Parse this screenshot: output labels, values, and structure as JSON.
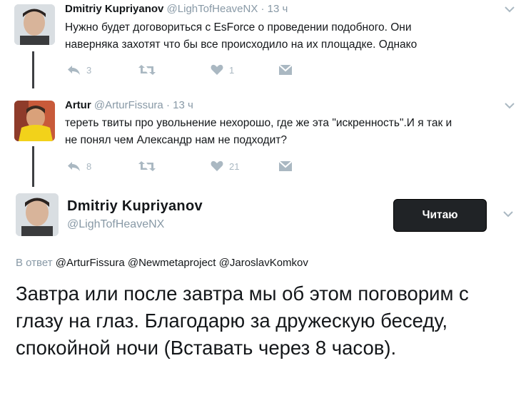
{
  "tweets": [
    {
      "name": "Dmitriy Kupriyanov",
      "handle": "@LighTofHeaveNX",
      "time": "· 13 ч",
      "lines": [
        "Нужно будет договориться с EsForce о проведении подобного. Они",
        "наверняка захотят что бы все происходило на их площадке. Однако"
      ],
      "reply_count": "3",
      "retweet_count": "",
      "like_count": "1"
    },
    {
      "name": "Artur",
      "handle": "@ArturFissura",
      "time": "· 13 ч",
      "lines": [
        "тереть твиты про увольнение нехорошо, где же эта \"искренность\".И я так и",
        "не понял чем Александр нам не подходит?"
      ],
      "reply_count": "8",
      "retweet_count": "",
      "like_count": "21"
    }
  ],
  "main_tweet": {
    "name": "Dmitriy Kupriyanov",
    "handle": "@LighTofHeaveNX",
    "follow_label": "Читаю",
    "reply_prefix": "В ответ",
    "mentions": [
      "@ArturFissura",
      "@Newmetaproject",
      "@JaroslavKomkov"
    ],
    "text": "Завтра или после завтра мы об этом поговорим с глазу на глаз. Благодарю за дружескую беседу, спокойной ночи (Вставать через 8 часов)."
  },
  "icons": {
    "reply": "reply-icon",
    "retweet": "retweet-icon",
    "like": "heart-icon",
    "dm": "direct-message-icon",
    "more": "chevron-down-icon"
  },
  "colors": {
    "meta": "#8899a6",
    "icon": "#aab8c2",
    "follow_button": "#202326"
  }
}
